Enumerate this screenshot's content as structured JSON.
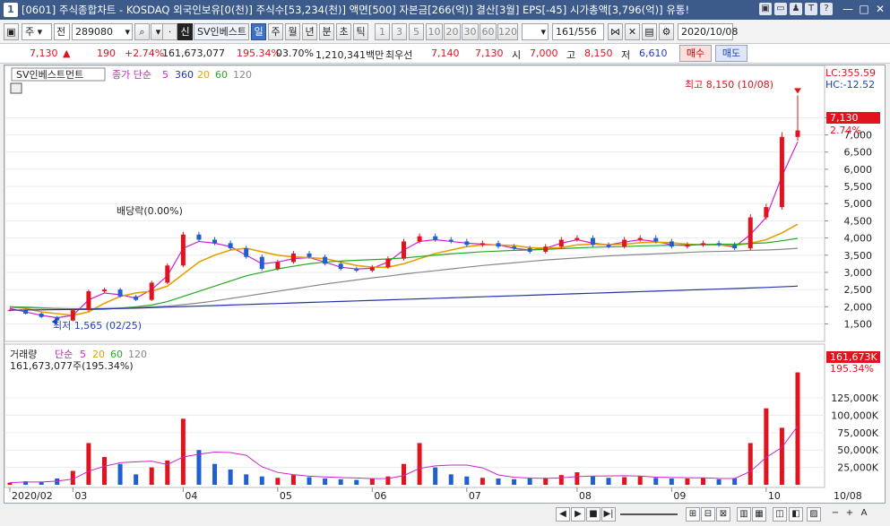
{
  "window": {
    "number": "1",
    "title": "[0601] 주식종합차트 - KOSDAQ 외국인보유[0(천)] 주식수[53,234(천)] 액면[500] 자본금[266(억)] 결산[3월] EPS[-45] 시가총액[3,796(억)] 유통!",
    "icons": [
      "▣",
      "▭",
      "♟",
      "T",
      "?"
    ],
    "controls": [
      "—",
      "□",
      "✕"
    ]
  },
  "toolbar": {
    "type_select": "주",
    "scope_select": "전",
    "code": "289080",
    "market_badge": "신",
    "name": "SV인베스트",
    "periods": [
      "일",
      "주",
      "월",
      "년",
      "분",
      "초",
      "틱"
    ],
    "active_period": "일",
    "intervals": [
      "1",
      "3",
      "5",
      "10",
      "20",
      "30",
      "60",
      "120"
    ],
    "count": "161",
    "total": "/556",
    "date": "2020/10/08"
  },
  "quote": {
    "price": "7,130",
    "arrow": "▲",
    "change": "190",
    "change_pct": "+2.74%",
    "volume": "161,673,077",
    "vol_ratio": "195.34%",
    "turnover": "03.70%",
    "amount": "1,210,341백만",
    "best_bid_label": "최우선",
    "best_bid1": "7,140",
    "best_bid2": "7,130",
    "open_label": "시",
    "open": "7,000",
    "high_label": "고",
    "high": "8,150",
    "low_label": "저",
    "low": "6,610",
    "buy_label": "매수",
    "sell_label": "매도"
  },
  "price_panel": {
    "name": "SV인베스트먼트",
    "legend_prefix": "종가 단순",
    "ma_periods": [
      "5",
      "360",
      "20",
      "60",
      "120"
    ],
    "ma_colors": [
      "#cc22cc",
      "#2233aa",
      "#e6a000",
      "#22aa22",
      "#888888"
    ],
    "lc": "LC:355.59",
    "hc": "HC:-12.52",
    "last_price_tag": "7,130",
    "last_pct_tag": "2.74%",
    "high_note": "최고 8,150 (10/08)",
    "low_note": "최저 1,565 (02/25)",
    "event_note": "배당락(0.00%)",
    "yticks": [
      "7,500",
      "7,000",
      "6,500",
      "6,000",
      "5,500",
      "5,000",
      "4,500",
      "4,000",
      "3,500",
      "3,000",
      "2,500",
      "2,000",
      "1,500"
    ],
    "yvalues": [
      7500,
      7000,
      6500,
      6000,
      5500,
      5000,
      4500,
      4000,
      3500,
      3000,
      2500,
      2000,
      1500
    ]
  },
  "volume_panel": {
    "name": "거래량",
    "legend_prefix": "단순",
    "ma_periods": [
      "5",
      "20",
      "60",
      "120"
    ],
    "ma_colors": [
      "#cc22cc",
      "#e6a000",
      "#22aa22",
      "#888888"
    ],
    "subtitle": "161,673,077주(195.34%)",
    "last_tag": "161,673K",
    "last_pct_tag": "195.34%",
    "yticks": [
      "125,000K",
      "100,000K",
      "75,000K",
      "50,000K",
      "25,000K"
    ],
    "yvalues": [
      125000,
      100000,
      75000,
      50000,
      25000
    ]
  },
  "xaxis": {
    "labels": [
      "2020/02",
      "03",
      "04",
      "05",
      "06",
      "07",
      "08",
      "09",
      "10"
    ],
    "last_label": "10/08"
  },
  "chart_data": {
    "type": "line",
    "x": [
      "02/12",
      "02/17",
      "02/21",
      "02/25",
      "03/02",
      "03/06",
      "03/11",
      "03/16",
      "03/20",
      "03/25",
      "03/30",
      "04/03",
      "04/08",
      "04/13",
      "04/17",
      "04/22",
      "04/27",
      "05/04",
      "05/08",
      "05/13",
      "05/18",
      "05/22",
      "05/27",
      "06/01",
      "06/05",
      "06/10",
      "06/15",
      "06/19",
      "06/24",
      "06/29",
      "07/03",
      "07/08",
      "07/13",
      "07/17",
      "07/22",
      "07/27",
      "07/31",
      "08/05",
      "08/10",
      "08/14",
      "08/20",
      "08/25",
      "08/31",
      "09/04",
      "09/09",
      "09/14",
      "09/18",
      "09/23",
      "09/28",
      "10/05",
      "10/08"
    ],
    "series": [
      {
        "name": "종가",
        "values": [
          1900,
          1800,
          1700,
          1600,
          1900,
          2450,
          2500,
          2300,
          2200,
          2700,
          3200,
          4100,
          3950,
          3850,
          3700,
          3450,
          3100,
          3300,
          3550,
          3450,
          3250,
          3100,
          3050,
          3150,
          3400,
          3900,
          4050,
          3950,
          3900,
          3800,
          3850,
          3750,
          3700,
          3600,
          3750,
          3950,
          4000,
          3800,
          3750,
          3950,
          4000,
          3900,
          3750,
          3800,
          3850,
          3800,
          3700,
          4600,
          4900,
          6940,
          7130
        ]
      },
      {
        "name": "5",
        "values": [
          1950,
          1850,
          1750,
          1680,
          1750,
          2200,
          2400,
          2350,
          2250,
          2500,
          2900,
          3700,
          3900,
          3850,
          3750,
          3500,
          3250,
          3300,
          3400,
          3430,
          3300,
          3150,
          3100,
          3120,
          3300,
          3650,
          3900,
          3950,
          3900,
          3850,
          3820,
          3800,
          3700,
          3650,
          3700,
          3850,
          3950,
          3850,
          3800,
          3880,
          3950,
          3900,
          3800,
          3780,
          3820,
          3800,
          3740,
          4100,
          4600,
          5800,
          6800
        ]
      },
      {
        "name": "20",
        "values": [
          2000,
          1950,
          1850,
          1800,
          1750,
          1850,
          2100,
          2300,
          2400,
          2450,
          2600,
          2950,
          3300,
          3500,
          3650,
          3700,
          3600,
          3500,
          3450,
          3430,
          3400,
          3300,
          3200,
          3150,
          3150,
          3250,
          3400,
          3550,
          3650,
          3750,
          3800,
          3800,
          3780,
          3720,
          3700,
          3720,
          3800,
          3820,
          3800,
          3820,
          3860,
          3880,
          3860,
          3820,
          3800,
          3800,
          3780,
          3850,
          3950,
          4150,
          4400
        ]
      },
      {
        "name": "60",
        "values": [
          2000,
          1990,
          1970,
          1950,
          1930,
          1920,
          1930,
          1960,
          2000,
          2050,
          2150,
          2300,
          2450,
          2600,
          2750,
          2900,
          3000,
          3100,
          3180,
          3250,
          3300,
          3330,
          3350,
          3370,
          3390,
          3420,
          3460,
          3500,
          3540,
          3570,
          3600,
          3620,
          3640,
          3650,
          3670,
          3690,
          3710,
          3730,
          3740,
          3750,
          3770,
          3780,
          3790,
          3800,
          3810,
          3820,
          3820,
          3840,
          3860,
          3920,
          3990
        ]
      },
      {
        "name": "120",
        "values": [
          1980,
          1970,
          1960,
          1950,
          1945,
          1945,
          1950,
          1960,
          1975,
          1995,
          2020,
          2060,
          2110,
          2170,
          2240,
          2310,
          2380,
          2450,
          2520,
          2590,
          2660,
          2720,
          2780,
          2840,
          2890,
          2950,
          3000,
          3050,
          3100,
          3150,
          3200,
          3240,
          3280,
          3320,
          3360,
          3390,
          3420,
          3450,
          3480,
          3500,
          3520,
          3540,
          3560,
          3580,
          3600,
          3610,
          3620,
          3640,
          3650,
          3670,
          3700
        ]
      },
      {
        "name": "360",
        "values": [
          1900,
          1905,
          1910,
          1915,
          1920,
          1930,
          1940,
          1950,
          1960,
          1975,
          1990,
          2005,
          2020,
          2035,
          2050,
          2065,
          2080,
          2095,
          2110,
          2125,
          2140,
          2155,
          2170,
          2185,
          2200,
          2215,
          2230,
          2245,
          2260,
          2275,
          2290,
          2305,
          2320,
          2335,
          2350,
          2365,
          2380,
          2395,
          2410,
          2425,
          2440,
          2455,
          2470,
          2485,
          2500,
          2515,
          2530,
          2545,
          2560,
          2580,
          2600
        ]
      }
    ],
    "volume": [
      3000,
      5000,
      4000,
      9000,
      20000,
      60000,
      40000,
      30000,
      15000,
      25000,
      35000,
      95000,
      50000,
      30000,
      22000,
      15000,
      12000,
      10000,
      14000,
      11000,
      9000,
      8000,
      7000,
      9000,
      12000,
      30000,
      60000,
      25000,
      15000,
      12000,
      10000,
      9000,
      8000,
      9000,
      10000,
      14000,
      18000,
      12000,
      10000,
      11000,
      12000,
      10000,
      9000,
      9000,
      10000,
      8000,
      9000,
      60000,
      110000,
      82000,
      161673
    ],
    "high": {
      "value": 8150,
      "date": "10/08"
    },
    "low": {
      "value": 1565,
      "date": "02/25"
    },
    "ylim": [
      1200,
      8500
    ],
    "volume_ylim": [
      0,
      165000
    ]
  }
}
